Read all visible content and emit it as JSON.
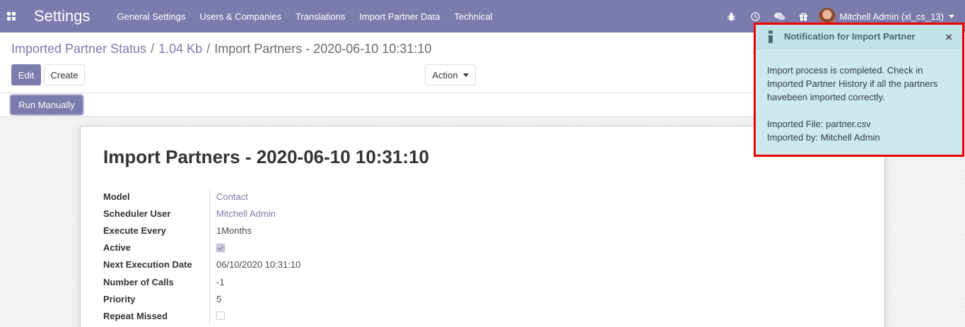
{
  "navbar": {
    "brand": "Settings",
    "menu": [
      "General Settings",
      "Users & Companies",
      "Translations",
      "Import Partner Data",
      "Technical"
    ],
    "user": "Mitchell Admin (xl_cs_13)",
    "icons": [
      "bug-icon",
      "clock-icon",
      "chat-icon",
      "gift-icon"
    ]
  },
  "breadcrumb": {
    "items": [
      "Imported Partner Status",
      "1.04 Kb"
    ],
    "separator": "/",
    "active": "Import Partners - 2020-06-10 10:31:10"
  },
  "buttons": {
    "edit": "Edit",
    "create": "Create",
    "action": "Action",
    "run_manually": "Run Manually"
  },
  "record": {
    "title": "Import Partners - 2020-06-10 10:31:10",
    "fields": {
      "model": {
        "label": "Model",
        "value": "Contact"
      },
      "scheduler_user": {
        "label": "Scheduler User",
        "value": "Mitchell Admin"
      },
      "execute_every": {
        "label": "Execute Every",
        "value": "1Months"
      },
      "active": {
        "label": "Active",
        "checked": true
      },
      "next_execution_date": {
        "label": "Next Execution Date",
        "value": "06/10/2020 10:31:10"
      },
      "number_of_calls": {
        "label": "Number of Calls",
        "value": "-1"
      },
      "priority": {
        "label": "Priority",
        "value": "5"
      },
      "repeat_missed": {
        "label": "Repeat Missed",
        "checked": false
      }
    }
  },
  "notification": {
    "title": "Notification for Import Partner",
    "close": "×",
    "message_lines": [
      "Import process is completed. Check in",
      "Imported Partner History if all the partners",
      "havebeen imported correctly."
    ],
    "file_line": "Imported File: partner.csv",
    "by_line": "Imported by: Mitchell Admin"
  },
  "colors": {
    "brand": "#7c7bad",
    "notification_bg": "#cce9ee",
    "highlight_border": "#e00000"
  }
}
